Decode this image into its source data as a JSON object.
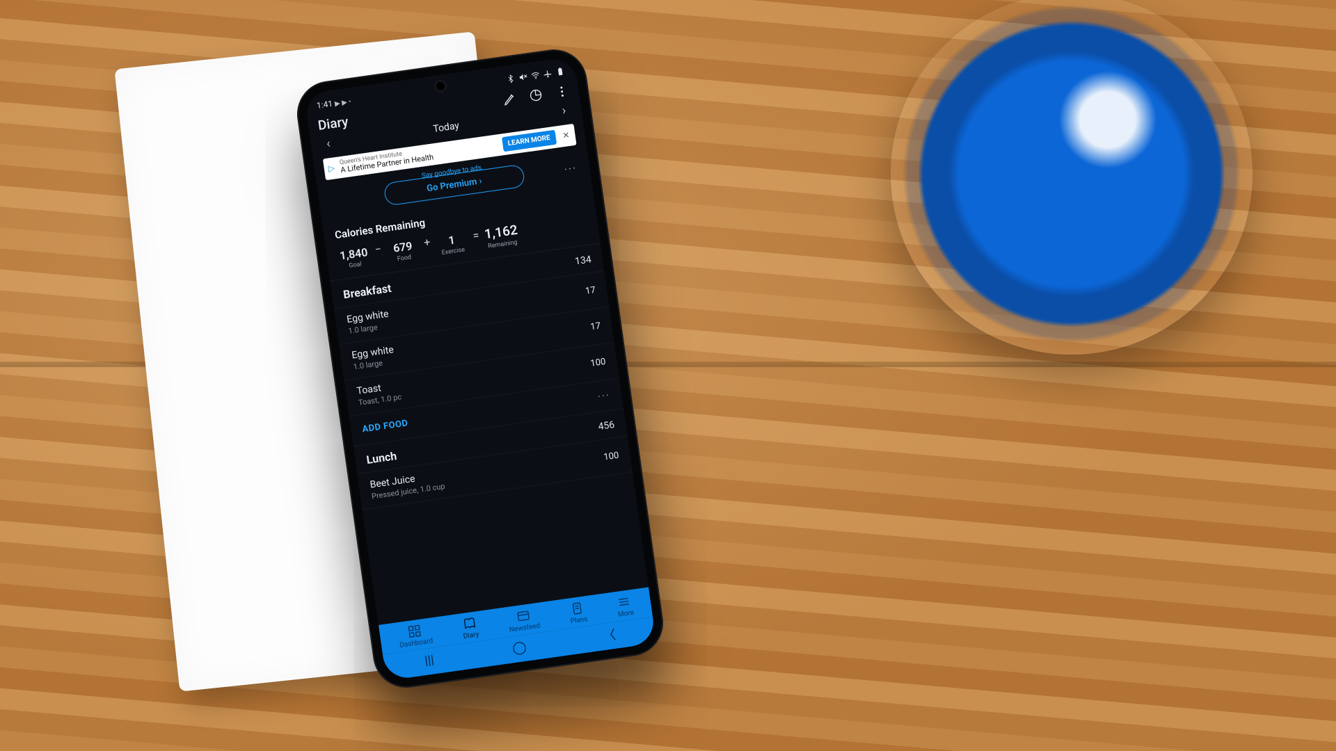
{
  "status": {
    "time": "1:41",
    "indicators": "▶ ▶ •"
  },
  "appbar": {
    "title": "Diary"
  },
  "date": {
    "label": "Today"
  },
  "ad": {
    "sponsor": "Queen's Heart Institute",
    "headline": "A Lifetime Partner in Health",
    "cta": "LEARN MORE"
  },
  "premium": {
    "tagline": "Say goodbye to ads.",
    "button": "Go Premium ›"
  },
  "calories": {
    "heading": "Calories Remaining",
    "goal": {
      "value": "1,840",
      "label": "Goal"
    },
    "food": {
      "value": "679",
      "label": "Food"
    },
    "exercise": {
      "value": "1",
      "label": "Exercise"
    },
    "remaining": {
      "value": "1,162",
      "label": "Remaining"
    }
  },
  "meals": {
    "breakfast": {
      "name": "Breakfast",
      "total": "134",
      "items": [
        {
          "name": "Egg white",
          "sub": "1.0 large",
          "cal": "17"
        },
        {
          "name": "Egg white",
          "sub": "1.0 large",
          "cal": "17"
        },
        {
          "name": "Toast",
          "sub": "Toast, 1.0 pc",
          "cal": "100"
        }
      ],
      "add": "ADD FOOD"
    },
    "lunch": {
      "name": "Lunch",
      "total": "456",
      "items": [
        {
          "name": "Beet Juice",
          "sub": "Pressed juice, 1.0 cup",
          "cal": "100"
        }
      ]
    }
  },
  "nav": {
    "dashboard": "Dashboard",
    "diary": "Diary",
    "newsfeed": "Newsfeed",
    "plans": "Plans",
    "more": "More"
  }
}
